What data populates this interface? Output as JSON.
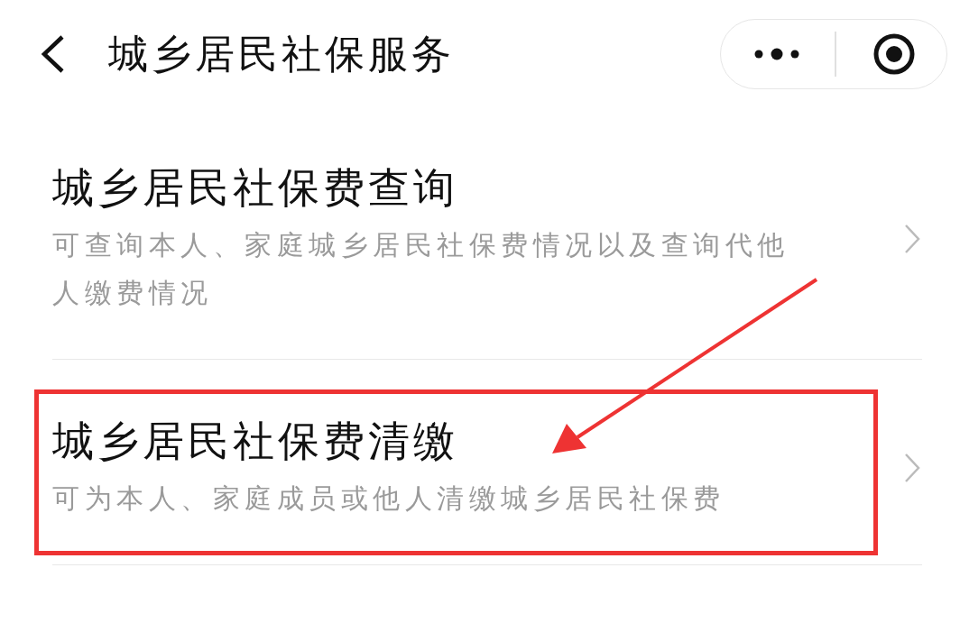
{
  "nav": {
    "title": "城乡居民社保服务"
  },
  "items": [
    {
      "title": "城乡居民社保费查询",
      "description": "可查询本人、家庭城乡居民社保费情况以及查询代他人缴费情况",
      "highlighted": false
    },
    {
      "title": "城乡居民社保费清缴",
      "description": "可为本人、家庭成员或他人清缴城乡居民社保费",
      "highlighted": true
    }
  ]
}
